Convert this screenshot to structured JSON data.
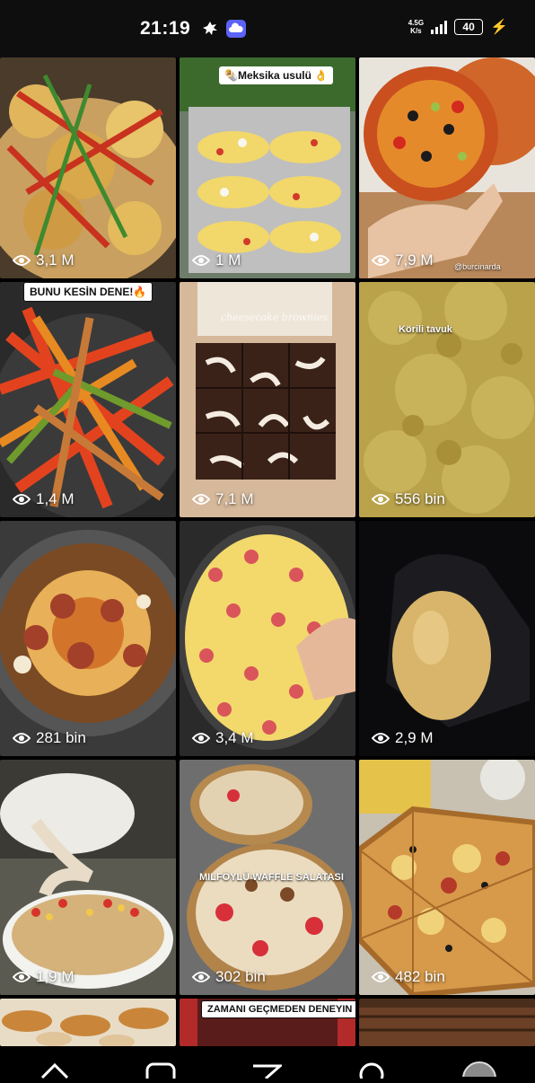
{
  "status_bar": {
    "time": "21:19",
    "network": "4.5G",
    "network_sub": "K/s",
    "battery": "40",
    "icons": [
      "notification-app-icon",
      "cloud-app-icon",
      "signal-icon",
      "battery-icon",
      "charging-icon"
    ]
  },
  "grid": {
    "tiles": [
      {
        "views": "3,1 M",
        "caption": ""
      },
      {
        "views": "1 M",
        "caption": "🌯Meksika usulü 👌"
      },
      {
        "views": "7,9 M",
        "caption": "@burcinarda"
      },
      {
        "views": "1,4 M",
        "caption": "BUNU KESİN DENE!🔥"
      },
      {
        "views": "7,1 M",
        "caption": "cheesecake brownies"
      },
      {
        "views": "556 bin",
        "caption": "Körili tavuk"
      },
      {
        "views": "281 bin",
        "caption": ""
      },
      {
        "views": "3,4 M",
        "caption": ""
      },
      {
        "views": "2,9 M",
        "caption": ""
      },
      {
        "views": "1,9 M",
        "caption": ""
      },
      {
        "views": "302 bin",
        "caption": "MILFÖYLÜ WAFFLE SALATASI"
      },
      {
        "views": "482 bin",
        "caption": ""
      },
      {
        "views": "",
        "caption": ""
      },
      {
        "views": "",
        "caption": "ZAMANI GEÇMEDEN DENEYIN"
      },
      {
        "views": "",
        "caption": ""
      }
    ]
  },
  "bottom_nav": {
    "items": [
      "home-icon",
      "reels-icon",
      "send-icon",
      "search-icon",
      "profile-avatar"
    ]
  },
  "colors": {
    "background": "#000000",
    "status_bar": "#0e0e0e",
    "text": "#ffffff"
  }
}
